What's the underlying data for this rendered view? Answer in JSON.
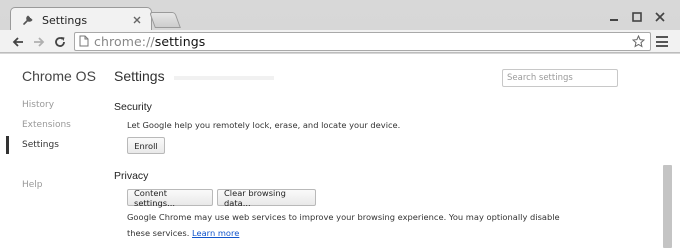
{
  "tab": {
    "title": "Settings",
    "icon": "wrench-icon"
  },
  "window_controls": [
    "minimize-icon",
    "maximize-icon",
    "close-icon"
  ],
  "omnibox": {
    "scheme": "chrome://",
    "host": "settings"
  },
  "sidebar": {
    "title": "Chrome OS",
    "items": [
      {
        "label": "History"
      },
      {
        "label": "Extensions"
      },
      {
        "label": "Settings",
        "selected": true
      },
      {
        "label": "Help"
      }
    ]
  },
  "main": {
    "title": "Settings",
    "search_placeholder": "Search settings",
    "security": {
      "title": "Security",
      "description": "Let Google help you remotely lock, erase, and locate your device.",
      "enroll_label": "Enroll"
    },
    "privacy": {
      "title": "Privacy",
      "content_settings_label": "Content settings...",
      "clear_data_label": "Clear browsing data...",
      "description_line1": "Google Chrome may use web services to improve your browsing experience. You may optionally disable",
      "description_line2": "these services.",
      "learn_more": "Learn more"
    }
  },
  "colors": {
    "link": "#1155cc",
    "selected_marker": "#333333"
  }
}
